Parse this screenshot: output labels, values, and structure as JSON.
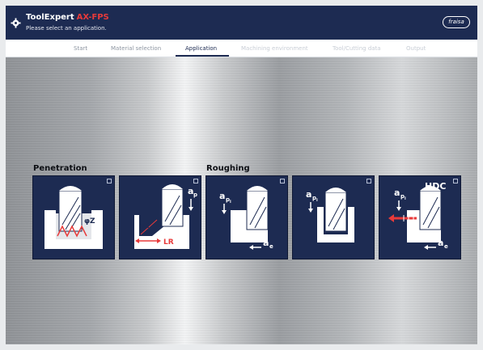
{
  "header": {
    "title": "ToolExpert",
    "title_accent": "AX-FPS",
    "subtitle": "Please select an application.",
    "logo_text": "fraisa"
  },
  "nav": {
    "tabs": [
      {
        "label": "Start",
        "state": "normal"
      },
      {
        "label": "Material selection",
        "state": "normal"
      },
      {
        "label": "Application",
        "state": "active"
      },
      {
        "label": "Machining environment",
        "state": "disabled"
      },
      {
        "label": "Tool/Cutting data",
        "state": "disabled"
      },
      {
        "label": "Output",
        "state": "disabled"
      }
    ]
  },
  "groups": {
    "penetration": "Penetration",
    "roughing": "Roughing"
  },
  "tiles": [
    {
      "name": "penetration-helix",
      "labels": [
        "φZ"
      ]
    },
    {
      "name": "penetration-ramp",
      "labels": [
        "a",
        "p",
        "φR",
        "LR"
      ]
    },
    {
      "name": "roughing-side",
      "labels": [
        "a",
        "p",
        "i",
        "a",
        "e"
      ]
    },
    {
      "name": "roughing-slot",
      "labels": [
        "a",
        "p",
        "i"
      ]
    },
    {
      "name": "roughing-hdc",
      "labels": [
        "a",
        "p",
        "i",
        "HDC",
        "a",
        "e"
      ]
    }
  ],
  "colors": {
    "header_bg": "#1d2b52",
    "accent": "#e83a3a",
    "tile_bg": "#1d2b52",
    "arrow_red": "#e83a3a"
  }
}
